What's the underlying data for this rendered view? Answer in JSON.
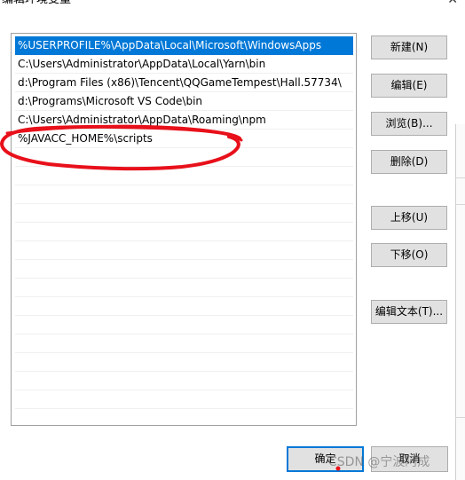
{
  "window": {
    "title": "编辑环境变量",
    "close_glyph": "✕"
  },
  "list": {
    "items": [
      {
        "text": "%USERPROFILE%\\AppData\\Local\\Microsoft\\WindowsApps",
        "selected": true
      },
      {
        "text": "C:\\Users\\Administrator\\AppData\\Local\\Yarn\\bin",
        "selected": false
      },
      {
        "text": "d:\\Program Files (x86)\\Tencent\\QQGameTempest\\Hall.57734\\",
        "selected": false
      },
      {
        "text": "d:\\Programs\\Microsoft VS Code\\bin",
        "selected": false
      },
      {
        "text": "C:\\Users\\Administrator\\AppData\\Roaming\\npm",
        "selected": false
      },
      {
        "text": "%JAVACC_HOME%\\scripts",
        "selected": false
      }
    ]
  },
  "buttons": {
    "new": "新建(N)",
    "edit": "编辑(E)",
    "browse": "浏览(B)...",
    "delete": "删除(D)",
    "move_up": "上移(U)",
    "move_down": "下移(O)",
    "edit_text": "编辑文本(T)...",
    "ok": "确定",
    "cancel": "取消"
  },
  "annotation": {
    "color": "#e8101a"
  },
  "watermark": {
    "text": "CSDN @宁波阿成"
  }
}
